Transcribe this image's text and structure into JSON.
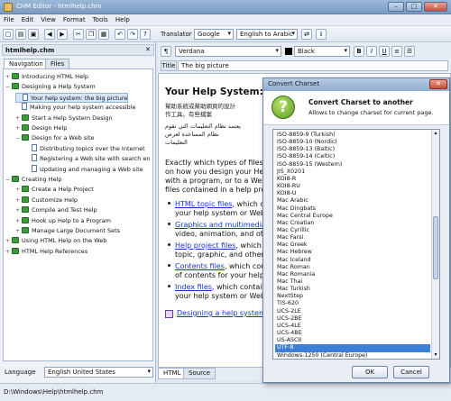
{
  "window": {
    "title": "CHM Editor - htmlhelp.chm"
  },
  "menu": [
    "File",
    "Edit",
    "View",
    "Format",
    "Tools",
    "Help"
  ],
  "toolbar": {
    "translator_label": "Translator",
    "engine": "Google",
    "direction": "English to Arabic"
  },
  "left_panel": {
    "file_title": "htmlhelp.chm",
    "tabs": [
      "Navigation",
      "Files"
    ],
    "tree": [
      {
        "label": "Introducing HTML Help",
        "level": 0,
        "icon": "book",
        "expander": "+"
      },
      {
        "label": "Designing a Help System",
        "level": 0,
        "icon": "book",
        "expander": "−"
      },
      {
        "label": "Your help system: the big picture",
        "level": 1,
        "icon": "page",
        "expander": "",
        "selected": true
      },
      {
        "label": "Making your help system accessible",
        "level": 1,
        "icon": "page",
        "expander": ""
      },
      {
        "label": "Start a Help System Design",
        "level": 1,
        "icon": "book",
        "expander": "+"
      },
      {
        "label": "Design Help",
        "level": 1,
        "icon": "book",
        "expander": "+"
      },
      {
        "label": "Design for a Web site",
        "level": 1,
        "icon": "book",
        "expander": "−"
      },
      {
        "label": "Distributing topics over the Internet",
        "level": 2,
        "icon": "page",
        "expander": ""
      },
      {
        "label": "Registering a Web site with search en",
        "level": 2,
        "icon": "page",
        "expander": ""
      },
      {
        "label": "Updating and managing a Web site",
        "level": 2,
        "icon": "page",
        "expander": ""
      },
      {
        "label": "Creating Help",
        "level": 0,
        "icon": "book",
        "expander": "−"
      },
      {
        "label": "Create a Help Project",
        "level": 1,
        "icon": "book",
        "expander": "+"
      },
      {
        "label": "Customize Help",
        "level": 1,
        "icon": "book",
        "expander": "+"
      },
      {
        "label": "Compile and Test Help",
        "level": 1,
        "icon": "book",
        "expander": "+"
      },
      {
        "label": "Hook up Help to a Program",
        "level": 1,
        "icon": "book",
        "expander": "+"
      },
      {
        "label": "Manage Large Document Sets",
        "level": 1,
        "icon": "book",
        "expander": "+"
      },
      {
        "label": "Using HTML Help on the Web",
        "level": 0,
        "icon": "book",
        "expander": "+"
      },
      {
        "label": "HTML Help References",
        "level": 0,
        "icon": "book",
        "expander": "+"
      }
    ],
    "language_label": "Language",
    "language_value": "English United States"
  },
  "editor": {
    "font": "Verdana",
    "color": "Black",
    "title_label": "Title",
    "title_value": "The big picture",
    "heading": "Your Help System: The",
    "cjk_lines": [
      "幫助系統或幫助網頁的設計",
      "作工具。有些檔案"
    ],
    "arabic_lines": [
      "يعتمد نظام التعليمات التي تقوم",
      "نظام المساعدة لعرض",
      "التعليمات"
    ],
    "para_lines": [
      "Exactly which types of files w",
      "on how you design your Help",
      "with a program, or to a Web",
      "files contained in a help pro"
    ],
    "bullets": [
      {
        "link": "HTML topic files",
        "rest": ", which cont",
        "line2": "your help system or Web"
      },
      {
        "link": "Graphics and multimedia f",
        "rest": "",
        "line2": "video, animation, and othe"
      },
      {
        "link": "Help project files",
        "rest": ", which co",
        "line2": "topic, graphic, and other"
      },
      {
        "link": "Contents files",
        "rest": ", which cont",
        "line2": "of contents for your help"
      },
      {
        "link": "Index files",
        "rest": ", which contai",
        "line2": "your help system or Web"
      }
    ],
    "footer_link": "Designing a help system",
    "bottom_tabs": [
      "HTML",
      "Source"
    ]
  },
  "status": {
    "path": "D:\\Windows\\Help\\htmlhelp.chm"
  },
  "dialog": {
    "title": "Convert Charset",
    "heading": "Convert Charset to another",
    "subtitle": "Allows to change charset for current page.",
    "charsets": [
      "ISO-8859-9 (Turkish)",
      "ISO-8859-10 (Nordic)",
      "ISO-8859-13 (Baltic)",
      "ISO-8859-14 (Celtic)",
      "ISO-8859-15 (Western)",
      "JIS_X0201",
      "KOI8-R",
      "KOI8-RU",
      "KOI8-U",
      "Mac Arabic",
      "Mac Dingbats",
      "Mac Central Europe",
      "Mac Croatian",
      "Mac Cyrillic",
      "Mac Farsi",
      "Mac Greek",
      "Mac Hebrew",
      "Mac Iceland",
      "Mac Roman",
      "Mac Romania",
      "Mac Thai",
      "Mac Turkish",
      "NextStep",
      "TIS-620",
      "UCS-2LE",
      "UCS-2BE",
      "UCS-4LE",
      "UCS-4BE",
      "US-ASCII",
      "UTF-8",
      "Windows-1250 (Central Europe)"
    ],
    "selected_charset": "UTF-8",
    "ok_label": "OK",
    "cancel_label": "Cancel"
  },
  "colors": {
    "accent": "#3d7fd6",
    "link": "#1433cc",
    "tree_book": "#3d9a3d"
  }
}
